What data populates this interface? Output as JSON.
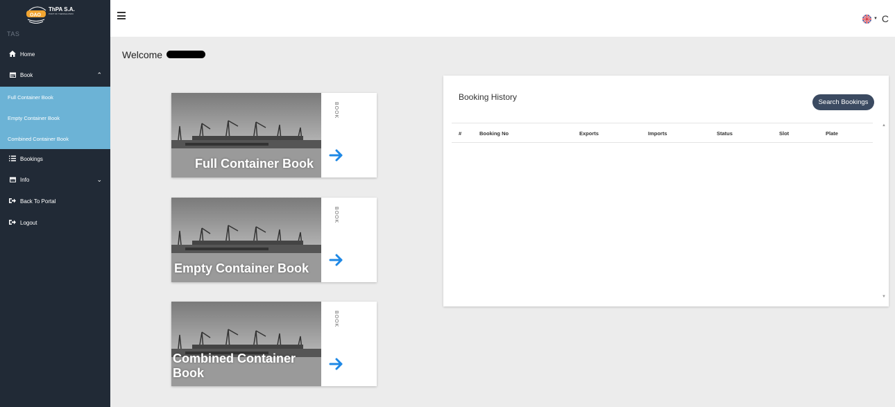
{
  "logo": {
    "name": "ThPA S.A.",
    "subtitle": "PORT OF THESSALONIKI"
  },
  "sidebar": {
    "app_code": "TAS",
    "items": [
      {
        "label": "Home",
        "icon": "home-icon"
      },
      {
        "label": "Book",
        "icon": "calendar-icon",
        "expanded": true
      },
      {
        "label": "Bookings",
        "icon": "list-icon"
      },
      {
        "label": "Info",
        "icon": "calendar-icon",
        "expanded": false
      },
      {
        "label": "Back To Portal",
        "icon": "sign-out-icon"
      },
      {
        "label": "Logout",
        "icon": "sign-out-icon"
      }
    ],
    "book_subitems": [
      {
        "label": "Full Container Book"
      },
      {
        "label": "Empty Container Book"
      },
      {
        "label": "Combined Container Book"
      }
    ]
  },
  "header": {
    "menu_icon": "hamburger-icon",
    "language_icon": "uk-flag-icon",
    "theme_icon": "moon-icon"
  },
  "main": {
    "welcome": "Welcome",
    "cards": [
      {
        "title": "Full Container Book",
        "tag": "BOOK",
        "icon": "arrow-right-icon"
      },
      {
        "title": "Empty Container Book",
        "tag": "BOOK",
        "icon": "arrow-right-icon"
      },
      {
        "title": "Combined Container Book",
        "tag": "BOOK",
        "icon": "arrow-right-icon"
      }
    ],
    "booking_history": {
      "title": "Booking History",
      "search_label": "Search Bookings",
      "columns": [
        "#",
        "Booking No",
        "Exports",
        "Imports",
        "Status",
        "Slot",
        "Plate"
      ],
      "rows": []
    }
  },
  "colors": {
    "sidebar_bg": "#212a36",
    "submenu_bg": "#6cb3d6",
    "button_bg": "#3b4a61",
    "accent": "#1e88e5"
  }
}
